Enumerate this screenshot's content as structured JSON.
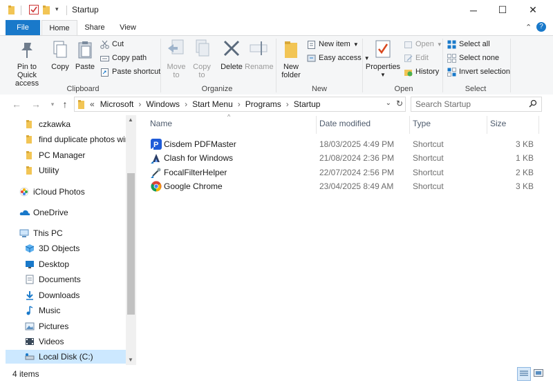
{
  "window": {
    "title": "Startup",
    "minimize_glyph": "─",
    "maximize_glyph": "☐",
    "close_glyph": "✕"
  },
  "ribbon_tabs": [
    "File",
    "Home",
    "Share",
    "View"
  ],
  "ribbon": {
    "clipboard": {
      "pin_label": "Pin to Quick access",
      "copy_label": "Copy",
      "paste_label": "Paste",
      "cut_label": "Cut",
      "copy_path_label": "Copy path",
      "paste_shortcut_label": "Paste shortcut",
      "group_label": "Clipboard"
    },
    "organize": {
      "move_to_label": "Move to",
      "copy_to_label": "Copy to",
      "delete_label": "Delete",
      "rename_label": "Rename",
      "group_label": "Organize"
    },
    "new": {
      "new_folder_label": "New folder",
      "new_item_label": "New item",
      "easy_access_label": "Easy access",
      "group_label": "New"
    },
    "open": {
      "properties_label": "Properties",
      "open_label": "Open",
      "edit_label": "Edit",
      "history_label": "History",
      "group_label": "Open"
    },
    "select": {
      "select_all_label": "Select all",
      "select_none_label": "Select none",
      "invert_label": "Invert selection",
      "group_label": "Select"
    }
  },
  "address": {
    "overflow": "«",
    "path": [
      "Microsoft",
      "Windows",
      "Start Menu",
      "Programs",
      "Startup"
    ],
    "search_placeholder": "Search Startup"
  },
  "nav": [
    {
      "label": "czkawka",
      "icon": "folder-icon"
    },
    {
      "label": "find duplicate photos win",
      "icon": "folder-icon"
    },
    {
      "label": "PC Manager",
      "icon": "folder-icon"
    },
    {
      "label": "Utility",
      "icon": "folder-icon"
    },
    {
      "label": "iCloud Photos",
      "icon": "icloud-photos-icon"
    },
    {
      "label": "OneDrive",
      "icon": "onedrive-icon"
    },
    {
      "label": "This PC",
      "icon": "this-pc-icon"
    },
    {
      "label": "3D Objects",
      "icon": "3d-objects-icon"
    },
    {
      "label": "Desktop",
      "icon": "desktop-icon"
    },
    {
      "label": "Documents",
      "icon": "documents-icon"
    },
    {
      "label": "Downloads",
      "icon": "downloads-icon"
    },
    {
      "label": "Music",
      "icon": "music-icon"
    },
    {
      "label": "Pictures",
      "icon": "pictures-icon"
    },
    {
      "label": "Videos",
      "icon": "videos-icon"
    },
    {
      "label": "Local Disk (C:)",
      "icon": "local-disk-icon"
    }
  ],
  "columns": {
    "name": "Name",
    "date": "Date modified",
    "type": "Type",
    "size": "Size"
  },
  "files": [
    {
      "name": "Cisdem PDFMaster",
      "date": "18/03/2025 4:49 PM",
      "type": "Shortcut",
      "size": "3 KB"
    },
    {
      "name": "Clash for Windows",
      "date": "21/08/2024 2:36 PM",
      "type": "Shortcut",
      "size": "1 KB"
    },
    {
      "name": "FocalFilterHelper",
      "date": "22/07/2024 2:56 PM",
      "type": "Shortcut",
      "size": "2 KB"
    },
    {
      "name": "Google Chrome",
      "date": "23/04/2025 8:49 AM",
      "type": "Shortcut",
      "size": "3 KB"
    }
  ],
  "status": {
    "item_count": "4 items"
  },
  "colors": {
    "accent": "#1979ca",
    "folder": "#f2c555",
    "selected_nav": "#cce8ff"
  }
}
